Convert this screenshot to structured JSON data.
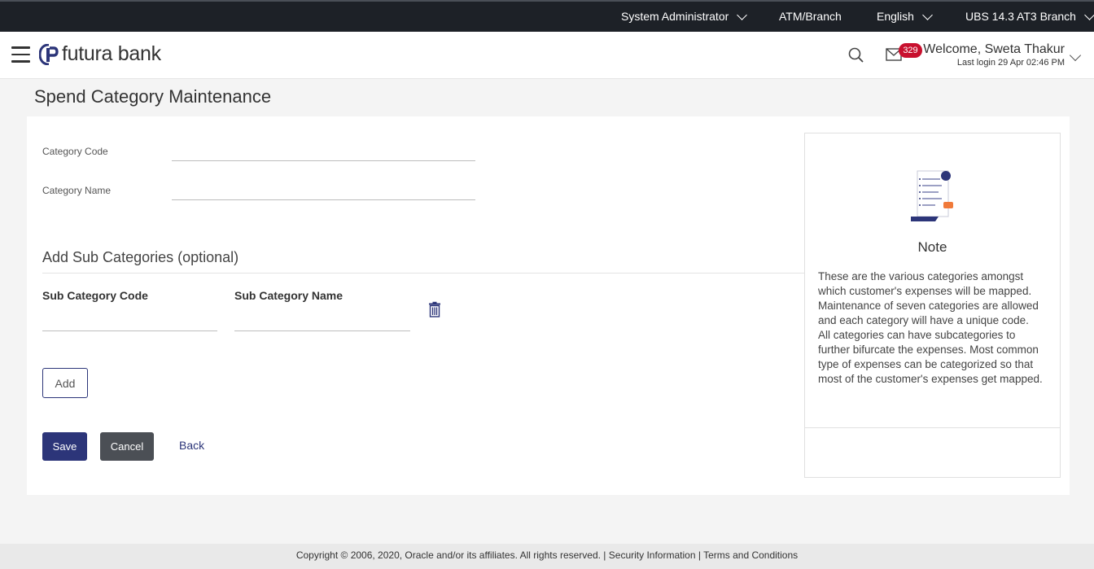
{
  "topbar": {
    "user_role": "System Administrator",
    "atm_branch": "ATM/Branch",
    "language": "English",
    "entity": "UBS 14.3 AT3 Branch"
  },
  "header": {
    "brand": "futura bank",
    "mail_count": "329",
    "welcome": "Welcome, Sweta Thakur",
    "last_login": "Last login 29 Apr 02:46 PM"
  },
  "page": {
    "title": "Spend Category Maintenance"
  },
  "form": {
    "category_code_label": "Category Code",
    "category_code_value": "",
    "category_name_label": "Category Name",
    "category_name_value": "",
    "sub_section_title": "Add Sub Categories (optional)",
    "sub_code_header": "Sub Category Code",
    "sub_name_header": "Sub Category Name",
    "sub_code_value": "",
    "sub_name_value": "",
    "add_label": "Add",
    "save_label": "Save",
    "cancel_label": "Cancel",
    "back_label": "Back"
  },
  "note": {
    "title": "Note",
    "text_1": "These are the various categories amongst which customer's expenses will be mapped. Maintenance of seven categories are allowed and each category will have a unique code.",
    "text_2": "All categories can have subcategories to further bifurcate the expenses. Most common type of expenses can be categorized so that most of the customer's expenses get mapped."
  },
  "footer": {
    "copyright": "Copyright © 2006, 2020, Oracle and/or its affiliates. All rights reserved. |",
    "security": "Security Information",
    "sep": "|",
    "terms": "Terms and Conditions"
  },
  "colors": {
    "primary": "#2c3579",
    "topbar": "#1d2127",
    "badge": "#c8102e"
  }
}
